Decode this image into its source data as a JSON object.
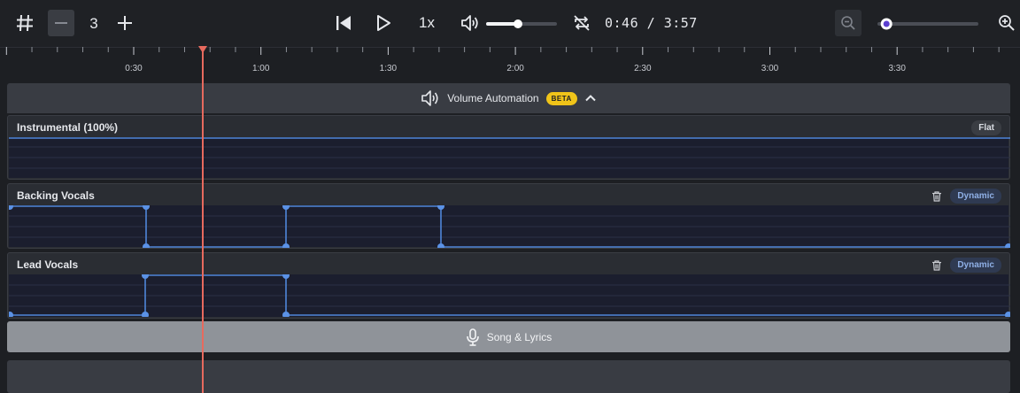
{
  "toolbar": {
    "grid_icon": "hash-icon",
    "minus_icon": "minus-icon",
    "count_value": "3",
    "plus_icon": "plus-icon",
    "skip_back_icon": "skip-back-icon",
    "play_icon": "play-icon",
    "speed_label": "1x",
    "volume_icon": "volume-icon",
    "volume_level": 0.45,
    "loop_icon": "repeat-off-icon",
    "time_display": "0:46 / 3:57",
    "zoom_out_icon": "zoom-out-icon",
    "zoom_level": 0.05,
    "zoom_in_icon": "zoom-in-icon"
  },
  "ruler": {
    "labels": [
      "0:30",
      "1:00",
      "1:30",
      "2:00",
      "2:30",
      "3:00",
      "3:30"
    ]
  },
  "playhead": {
    "position": "0:46"
  },
  "automation": {
    "title": "Volume Automation",
    "badge": "BETA",
    "collapse_icon": "chevron-up-icon"
  },
  "lanes": [
    {
      "name": "Instrumental (100%)",
      "mode": "Flat"
    },
    {
      "name": "Backing Vocals",
      "mode": "Dynamic"
    },
    {
      "name": "Lead Vocals",
      "mode": "Dynamic"
    }
  ],
  "song_bar": {
    "label": "Song & Lyrics",
    "icon": "microphone-icon"
  },
  "colors": {
    "playhead": "#e76a5e",
    "curve": "#4f86d9",
    "beta_badge": "#f0c419"
  }
}
